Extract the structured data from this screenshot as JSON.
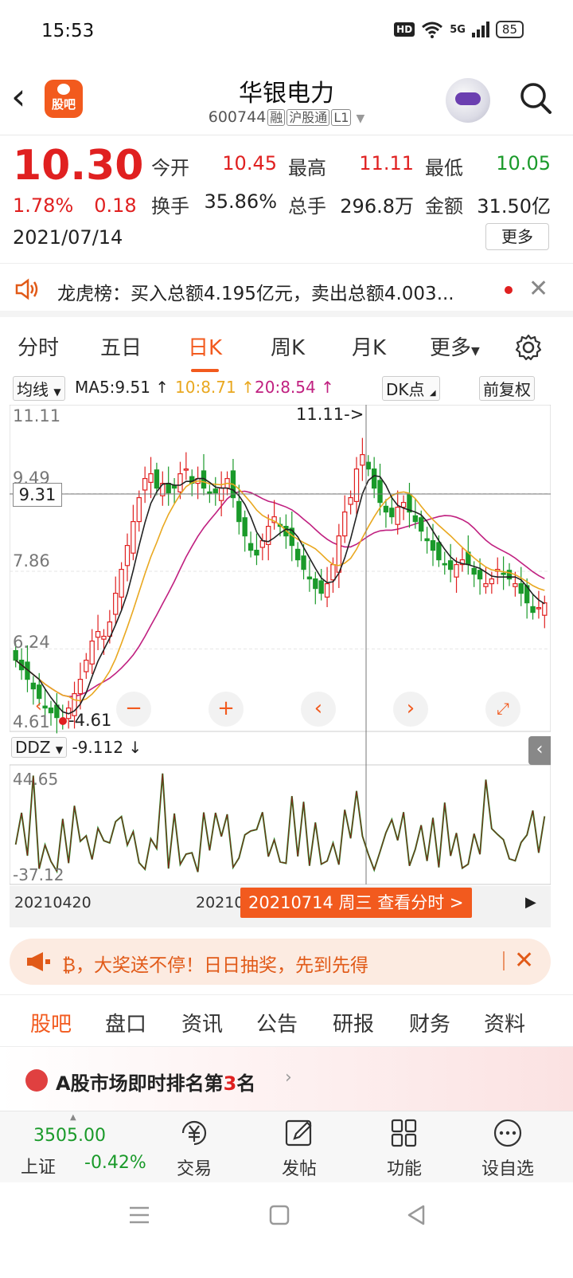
{
  "status": {
    "time": "15:53",
    "hd": "HD",
    "net": "5G",
    "battery": "85"
  },
  "header": {
    "title": "华银电力",
    "code": "600744",
    "tags": [
      "融",
      "沪股通",
      "L1"
    ]
  },
  "logo": {
    "label": "股吧"
  },
  "quote": {
    "price": "10.30",
    "pct": "1.78%",
    "chg": "0.18",
    "date": "2021/07/14",
    "rows": [
      [
        {
          "label": "今开",
          "value": "10.45",
          "color": "red"
        },
        {
          "label": "最高",
          "value": "11.11",
          "color": "red"
        },
        {
          "label": "最低",
          "value": "10.05",
          "color": "green"
        }
      ],
      [
        {
          "label": "换手",
          "value": "35.86%",
          "color": "dark"
        },
        {
          "label": "总手",
          "value": "296.8万",
          "color": "dark"
        },
        {
          "label": "金额",
          "value": "31.50亿",
          "color": "dark"
        }
      ]
    ],
    "more": "更多"
  },
  "notice": {
    "text": "龙虎榜：买入总额4.195亿元，卖出总额4.003..."
  },
  "ktabs": [
    "分时",
    "五日",
    "日K",
    "周K",
    "月K",
    "更多"
  ],
  "ktabs_active": "日K",
  "ma": {
    "selector": "均线",
    "ma5": "MA5:9.51",
    "ma10": "10:8.71",
    "ma20": "20:8.54",
    "dk": "DK点",
    "fq": "前复权"
  },
  "chart": {
    "ticks": [
      "11.11",
      "9.49",
      "7.86",
      "6.24",
      "4.61"
    ],
    "crosshair": "9.31",
    "max_label": "11.11->",
    "min_label": "-4.61",
    "ind_name": "DDZ",
    "ind_value": "-9.112",
    "ind_ticks": [
      "44.65",
      "-37.12"
    ],
    "date_left": "20210420",
    "date_mid": "20210",
    "date_pill": "20210714 周三 查看分时 >"
  },
  "chart_data": {
    "type": "candlestick",
    "ylim": [
      4.61,
      11.11
    ],
    "close": [
      6.0,
      5.8,
      5.6,
      5.4,
      5.2,
      5.0,
      4.9,
      4.8,
      4.7,
      5.0,
      5.3,
      5.6,
      6.0,
      6.4,
      6.6,
      6.5,
      6.8,
      7.4,
      7.9,
      8.4,
      8.9,
      9.4,
      9.8,
      9.9,
      9.6,
      9.7,
      9.5,
      9.6,
      9.9,
      10.0,
      9.7,
      9.8,
      9.6,
      9.5,
      9.5,
      9.6,
      9.8,
      9.4,
      8.9,
      8.6,
      8.3,
      8.2,
      8.5,
      8.8,
      9.0,
      8.8,
      8.6,
      8.4,
      8.1,
      7.9,
      7.7,
      7.5,
      7.4,
      7.6,
      8.0,
      8.6,
      9.1,
      9.4,
      10.0,
      10.3,
      10.0,
      9.6,
      9.3,
      9.1,
      9.0,
      9.2,
      9.3,
      9.1,
      8.9,
      8.7,
      8.5,
      8.3,
      8.1,
      8.0,
      7.9,
      8.0,
      8.1,
      8.0,
      7.8,
      7.7,
      7.6,
      7.7,
      7.9,
      7.8,
      7.7,
      7.6,
      7.4,
      7.2,
      7.0,
      7.1,
      7.2
    ]
  },
  "promo": {
    "text": "₿，大奖送不停！日日抽奖，先到先得"
  },
  "btabs": [
    "股吧",
    "盘口",
    "资讯",
    "公告",
    "研报",
    "财务",
    "资料"
  ],
  "rank": {
    "pre": "A股市场即时排名第",
    "num": "3",
    "post": "名"
  },
  "index": {
    "value": "3505.00",
    "name": "上证",
    "pct": "-0.42%"
  },
  "nav": [
    {
      "label": "交易",
      "icon": "yen-icon"
    },
    {
      "label": "发帖",
      "icon": "edit-icon"
    },
    {
      "label": "功能",
      "icon": "grid-icon"
    },
    {
      "label": "设自选",
      "icon": "more-icon"
    }
  ]
}
